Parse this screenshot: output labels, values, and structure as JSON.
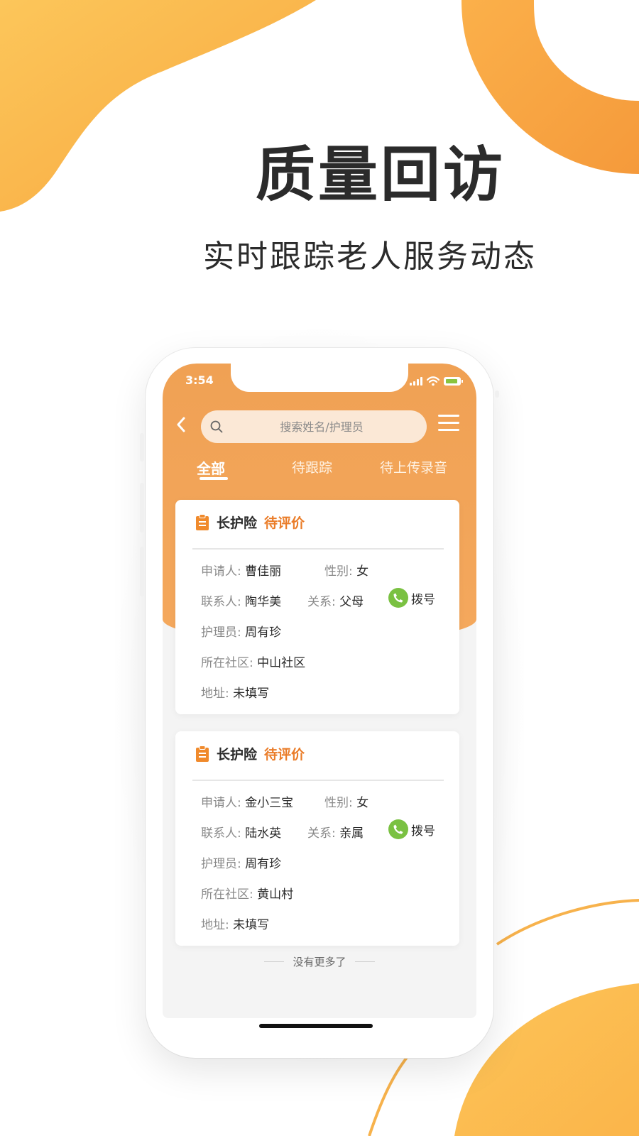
{
  "promo": {
    "title": "质量回访",
    "subtitle": "实时跟踪老人服务动态"
  },
  "colors": {
    "accent": "#f4a85d",
    "status_orange": "#ea7c28",
    "dial_green": "#7ac142",
    "deco_yellow": "#fbbd4e"
  },
  "status_bar": {
    "time": "3:54",
    "icons": [
      "signal-icon",
      "wifi-icon",
      "battery-charging-icon"
    ]
  },
  "header": {
    "back_icon": "chevron-left-icon",
    "search": {
      "placeholder": "搜索姓名/护理员",
      "value": ""
    },
    "menu_icon": "hamburger-menu-icon"
  },
  "tabs": [
    {
      "label": "全部",
      "active": true
    },
    {
      "label": "待跟踪",
      "active": false
    },
    {
      "label": "待上传录音",
      "active": false
    }
  ],
  "records": [
    {
      "type": "长护险",
      "status": "待评价",
      "applicant_label": "申请人:",
      "applicant": "曹佳丽",
      "gender_label": "性别:",
      "gender": "女",
      "contact_label": "联系人:",
      "contact": "陶华美",
      "relation_label": "关系:",
      "relation": "父母",
      "dial_label": "拨号",
      "caregiver_label": "护理员:",
      "caregiver": "周有珍",
      "community_label": "所在社区:",
      "community": "中山社区",
      "address_label": "地址:",
      "address": "未填写"
    },
    {
      "type": "长护险",
      "status": "待评价",
      "applicant_label": "申请人:",
      "applicant": "金小三宝",
      "gender_label": "性别:",
      "gender": "女",
      "contact_label": "联系人:",
      "contact": "陆水英",
      "relation_label": "关系:",
      "relation": "亲属",
      "dial_label": "拨号",
      "caregiver_label": "护理员:",
      "caregiver": "周有珍",
      "community_label": "所在社区:",
      "community": "黄山村",
      "address_label": "地址:",
      "address": "未填写"
    }
  ],
  "list_end_text": "没有更多了"
}
